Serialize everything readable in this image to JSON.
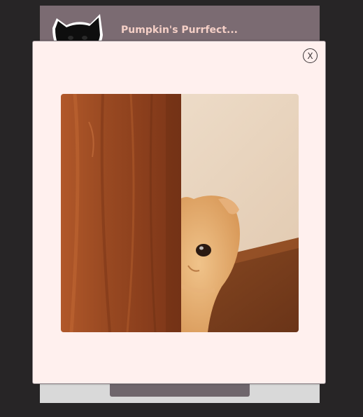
{
  "app": {
    "title": "Pumpkin's Purrfect...",
    "logo_icon": "black-cat-logo-icon",
    "header_color": "#7b6b72",
    "title_color": "#f4cfc6"
  },
  "modal": {
    "close_label": "X",
    "close_icon": "close-icon",
    "image_subject": "cat-peeking-behind-wooden-door-image"
  },
  "colors": {
    "backdrop": "#272526",
    "modal_background": "#fff0ee"
  }
}
